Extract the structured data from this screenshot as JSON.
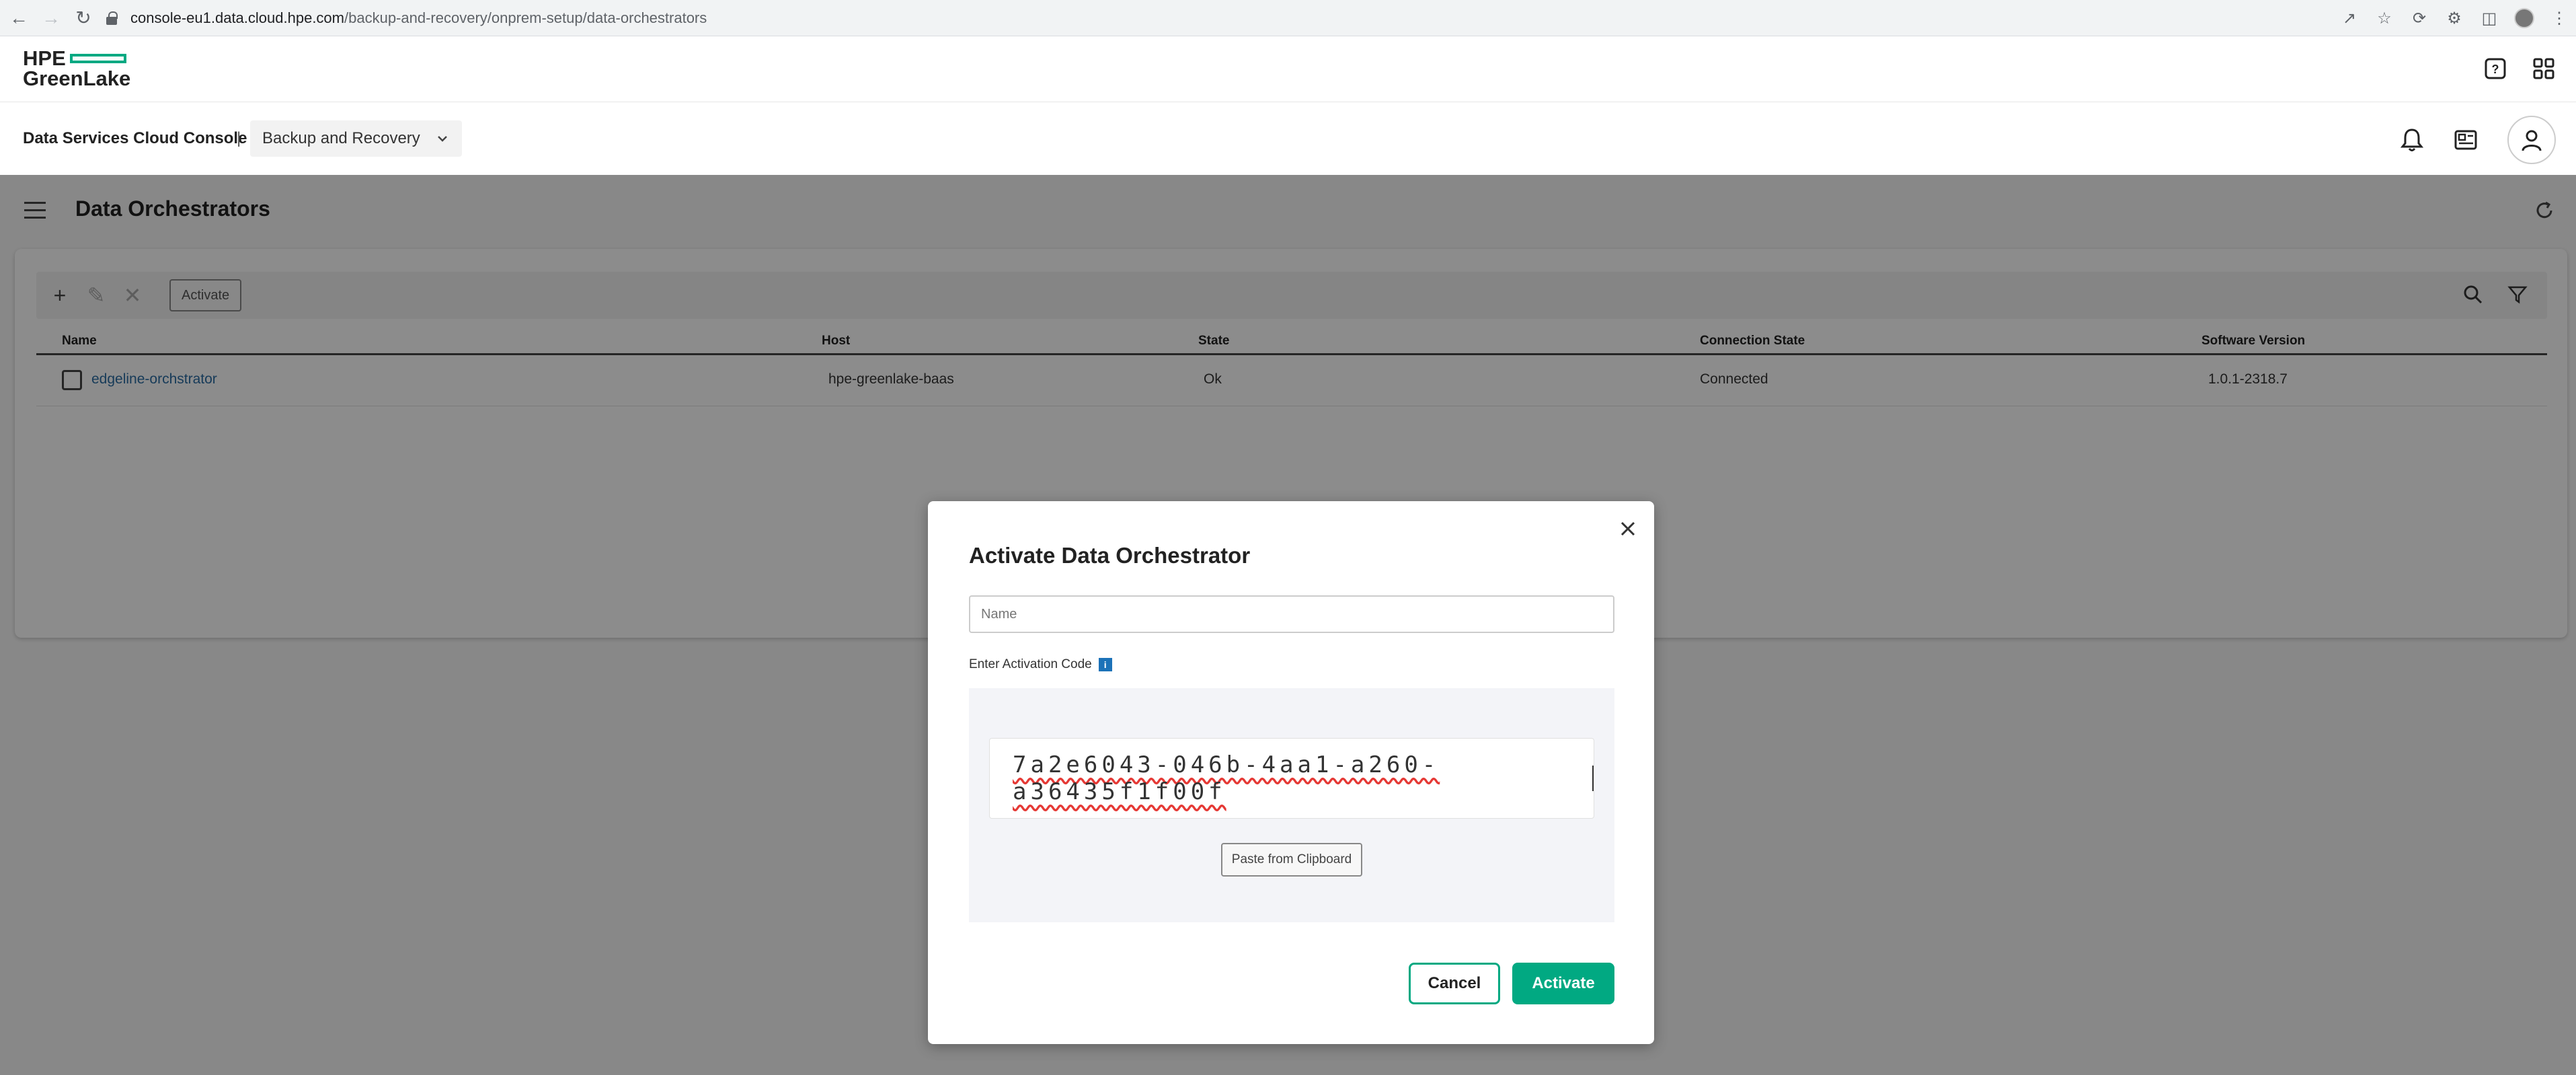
{
  "browser": {
    "url_host": "console-eu1.data.cloud.hpe.com",
    "url_path": "/backup-and-recovery/onprem-setup/data-orchestrators"
  },
  "header": {
    "logo_line1": "HPE",
    "logo_line2": "GreenLake",
    "brand_color": "#01a982"
  },
  "subheader": {
    "console_title": "Data Services Cloud Console",
    "separator": "|",
    "service": "Backup and Recovery"
  },
  "page": {
    "title": "Data Orchestrators"
  },
  "toolbar": {
    "activate_label": "Activate"
  },
  "table": {
    "columns": [
      "Name",
      "Host",
      "State",
      "Connection State",
      "Software Version"
    ],
    "rows": [
      {
        "name": "edgeline-orchstrator",
        "host": "hpe-greenlake-baas",
        "state": "Ok",
        "connection_state": "Connected",
        "software_version": "1.0.1-2318.7"
      }
    ]
  },
  "modal": {
    "title": "Activate Data Orchestrator",
    "name_placeholder": "Name",
    "activation_label": "Enter Activation Code",
    "info_glyph": "i",
    "activation_code": "7a2e6043-046b-4aa1-a260-a36435f1f00f",
    "paste_label": "Paste from Clipboard",
    "cancel_label": "Cancel",
    "activate_label": "Activate"
  }
}
